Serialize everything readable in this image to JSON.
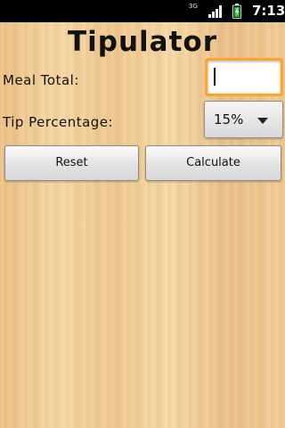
{
  "status_bar": {
    "network_type": "3G",
    "time": "7:13",
    "battery_color": "#20c020"
  },
  "app": {
    "title": "Tipulator",
    "meal_total_label": "Meal Total:",
    "tip_percentage_label": "Tip Percentage:",
    "meal_total_value": "",
    "meal_total_placeholder": "",
    "tip_percentage_selected": "15%",
    "reset_label": "Reset",
    "calculate_label": "Calculate",
    "input_focus_color": "#ffa629",
    "background_color": "#f0c48a"
  },
  "icons": {
    "signal": "cellular-signal-icon",
    "battery": "battery-icon",
    "dropdown": "chevron-down-icon"
  }
}
